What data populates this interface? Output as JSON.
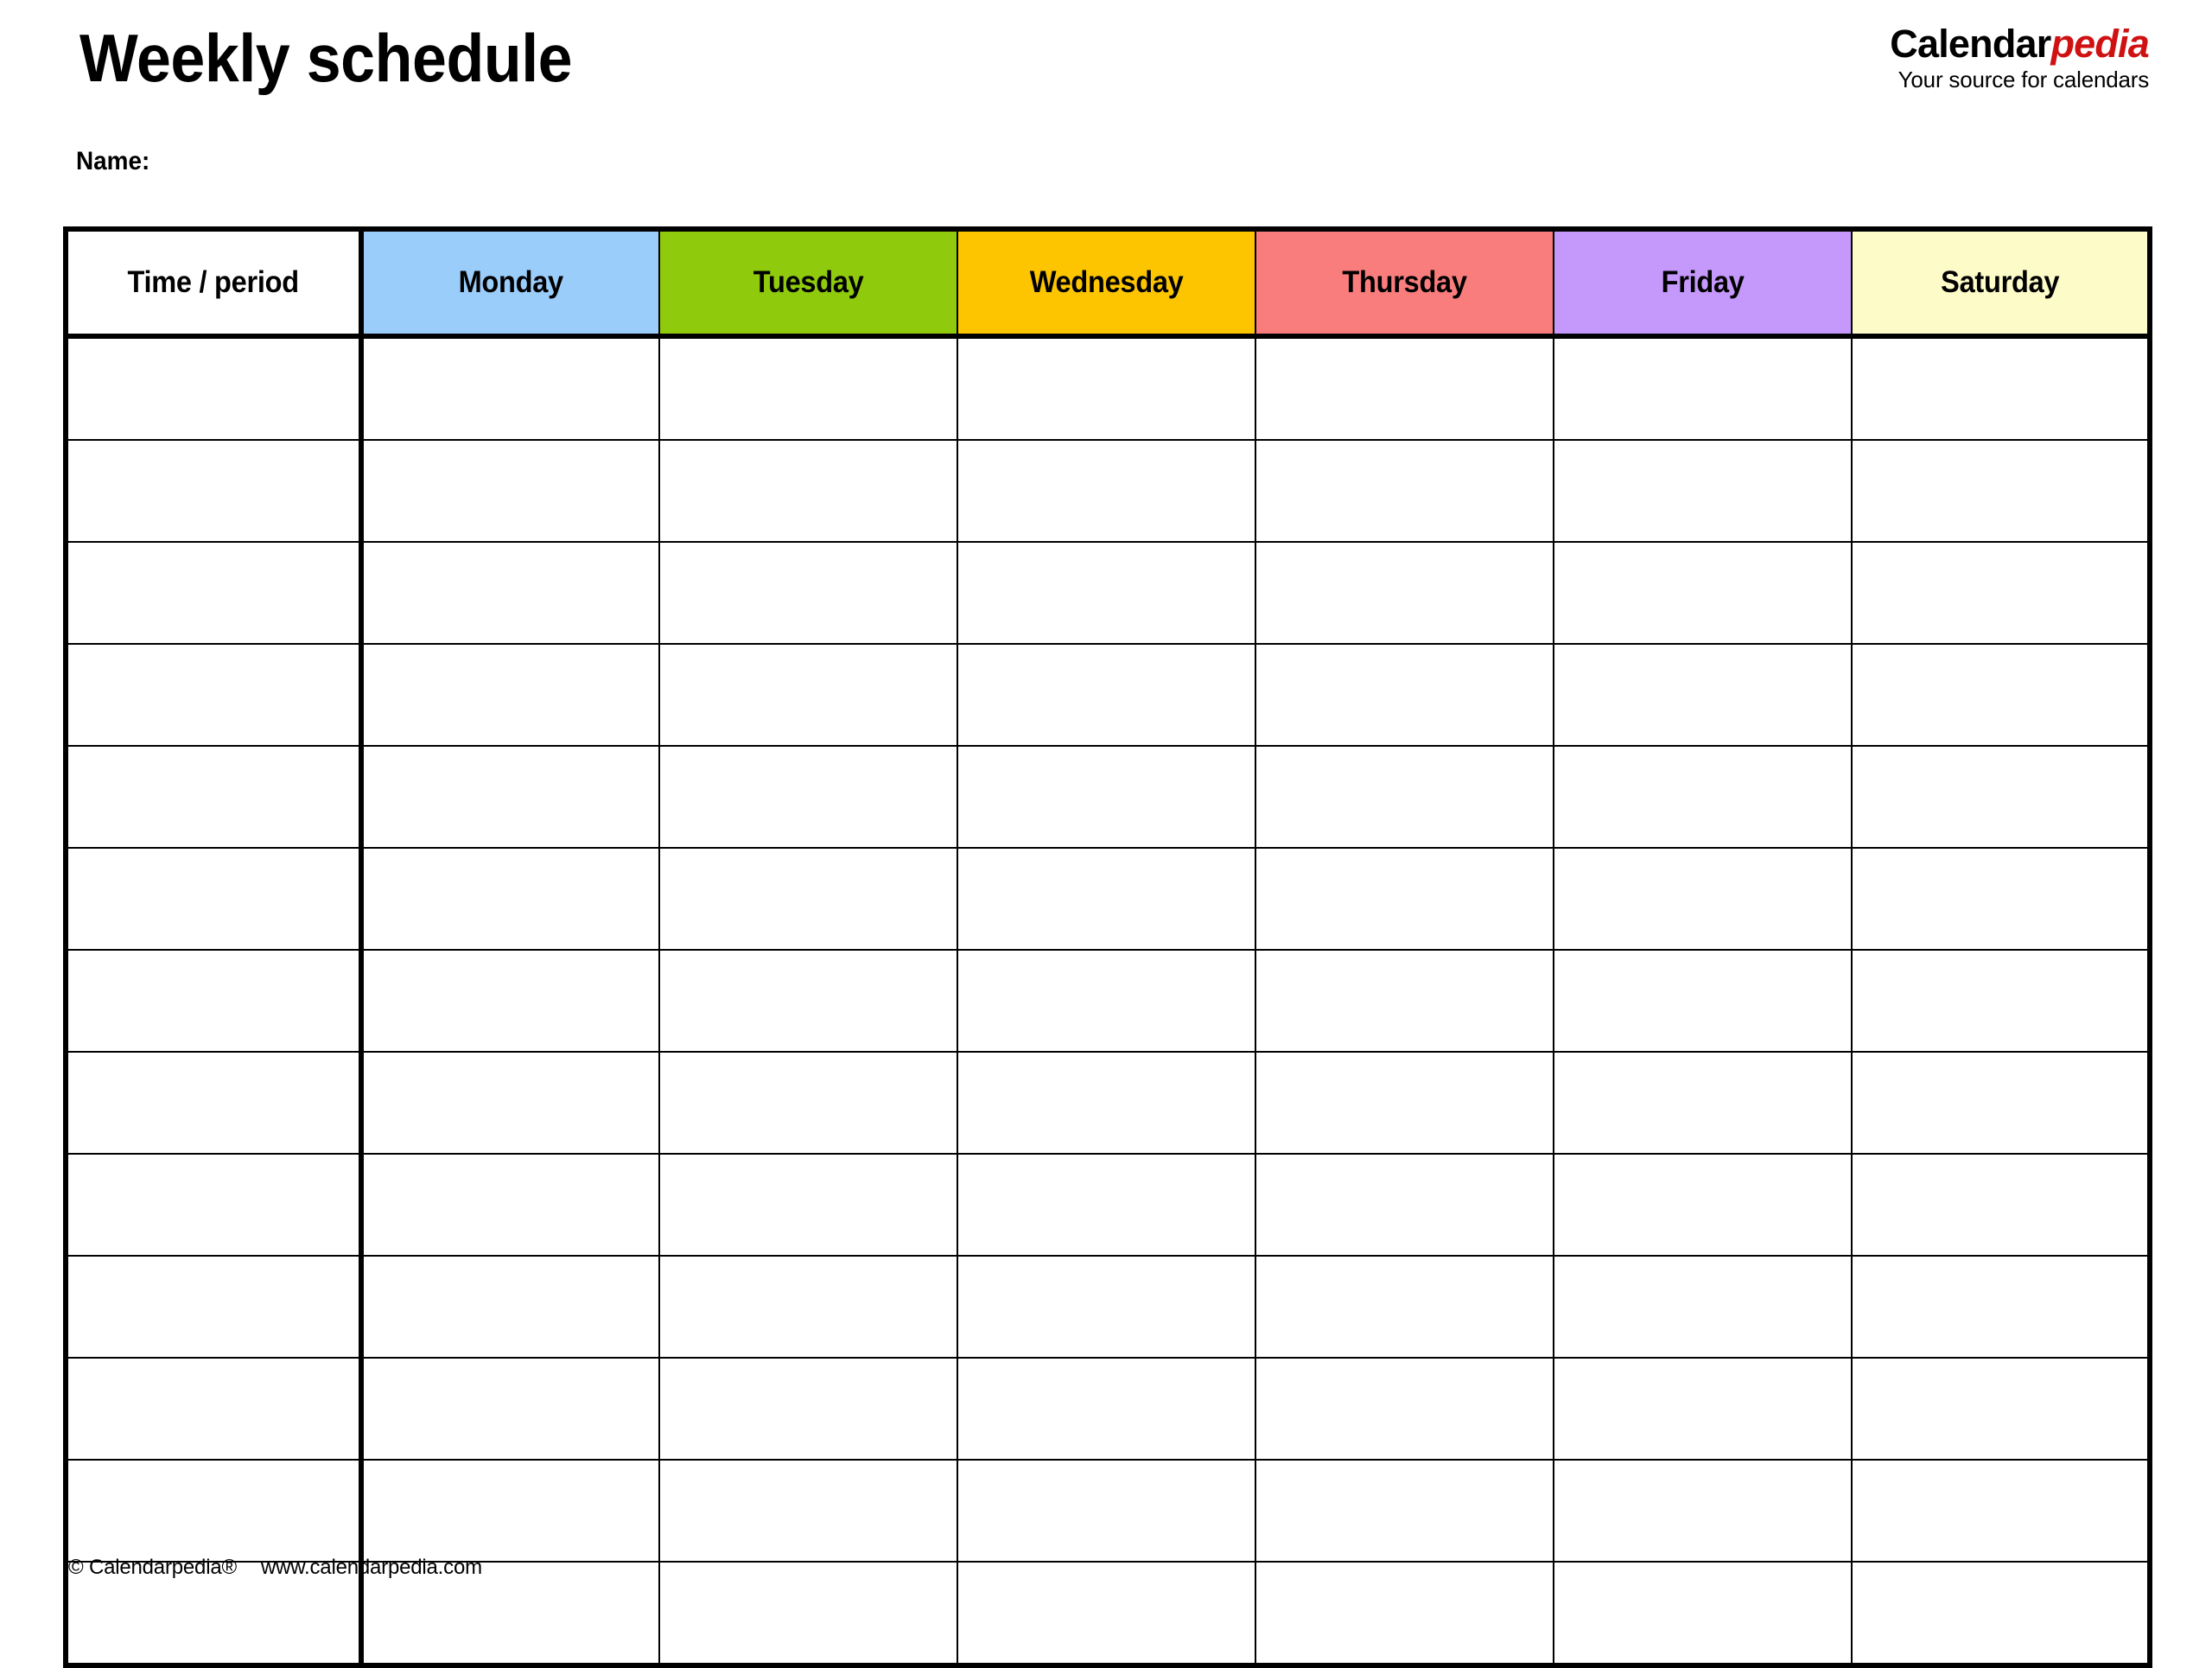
{
  "page": {
    "title": "Weekly schedule",
    "name_label": "Name:"
  },
  "brand": {
    "word_primary": "Calendar",
    "word_accent": "pedia",
    "tagline": "Your source for calendars",
    "accent_color": "#CF1112",
    "primary_color": "#000000"
  },
  "table": {
    "columns": [
      {
        "label": "Time / period",
        "color": "#FFFFFF",
        "key": "time"
      },
      {
        "label": "Monday",
        "color": "#9BCDFB",
        "key": "monday"
      },
      {
        "label": "Tuesday",
        "color": "#8FCB0C",
        "key": "tuesday"
      },
      {
        "label": "Wednesday",
        "color": "#FDC500",
        "key": "wednesday"
      },
      {
        "label": "Thursday",
        "color": "#FA7D7D",
        "key": "thursday"
      },
      {
        "label": "Friday",
        "color": "#C598FB",
        "key": "friday"
      },
      {
        "label": "Saturday",
        "color": "#FDFBC8",
        "key": "saturday"
      }
    ],
    "row_count": 13,
    "rows": [
      {
        "time": "",
        "monday": "",
        "tuesday": "",
        "wednesday": "",
        "thursday": "",
        "friday": "",
        "saturday": ""
      },
      {
        "time": "",
        "monday": "",
        "tuesday": "",
        "wednesday": "",
        "thursday": "",
        "friday": "",
        "saturday": ""
      },
      {
        "time": "",
        "monday": "",
        "tuesday": "",
        "wednesday": "",
        "thursday": "",
        "friday": "",
        "saturday": ""
      },
      {
        "time": "",
        "monday": "",
        "tuesday": "",
        "wednesday": "",
        "thursday": "",
        "friday": "",
        "saturday": ""
      },
      {
        "time": "",
        "monday": "",
        "tuesday": "",
        "wednesday": "",
        "thursday": "",
        "friday": "",
        "saturday": ""
      },
      {
        "time": "",
        "monday": "",
        "tuesday": "",
        "wednesday": "",
        "thursday": "",
        "friday": "",
        "saturday": ""
      },
      {
        "time": "",
        "monday": "",
        "tuesday": "",
        "wednesday": "",
        "thursday": "",
        "friday": "",
        "saturday": ""
      },
      {
        "time": "",
        "monday": "",
        "tuesday": "",
        "wednesday": "",
        "thursday": "",
        "friday": "",
        "saturday": ""
      },
      {
        "time": "",
        "monday": "",
        "tuesday": "",
        "wednesday": "",
        "thursday": "",
        "friday": "",
        "saturday": ""
      },
      {
        "time": "",
        "monday": "",
        "tuesday": "",
        "wednesday": "",
        "thursday": "",
        "friday": "",
        "saturday": ""
      },
      {
        "time": "",
        "monday": "",
        "tuesday": "",
        "wednesday": "",
        "thursday": "",
        "friday": "",
        "saturday": ""
      },
      {
        "time": "",
        "monday": "",
        "tuesday": "",
        "wednesday": "",
        "thursday": "",
        "friday": "",
        "saturday": ""
      },
      {
        "time": "",
        "monday": "",
        "tuesday": "",
        "wednesday": "",
        "thursday": "",
        "friday": "",
        "saturday": ""
      }
    ]
  },
  "footer": {
    "copyright": "© Calendarpedia®",
    "website": "www.calendarpedia.com"
  }
}
